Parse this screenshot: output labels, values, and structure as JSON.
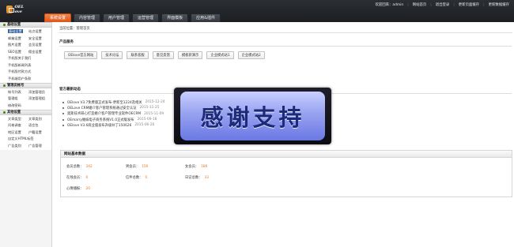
{
  "header": {
    "logo_text": "OEL ove",
    "welcome": "欢迎回来：admin",
    "links": [
      "网站首页",
      "退出登录",
      "更新页面缓存",
      "更新数据缓存"
    ],
    "tabs": [
      "系统设置",
      "内容管理",
      "用户管理",
      "运营管理",
      "界面模板",
      "应用&插件"
    ],
    "active_tab": "系统设置"
  },
  "sidebar": {
    "groups": [
      {
        "title": "基础设置",
        "items": [
          "基础设置",
          "站点设置",
          "邮箱设置",
          "安全设置",
          "图片设置",
          "会员设置",
          "SEO设置",
          "佣金设置",
          "手机版关于我们",
          "手机版新闻列表",
          "手机版付款方式",
          "手机端用户条款"
        ]
      },
      {
        "title": "管理员帐号",
        "items": [
          "帐号列表",
          "添加管理员",
          "管理组",
          "添加管理组",
          "修改密码"
        ]
      },
      {
        "title": "其他设置",
        "items": [
          "文章类型",
          "文章类别",
          "问卷调查",
          "语言包",
          "地区设置",
          "户籍设置",
          "自定义HTML标签",
          "广告类别",
          "广告管理"
        ]
      }
    ]
  },
  "main": {
    "breadcrumb": "当前位置：管理首页",
    "quick_title": "产品服务",
    "quick_buttons": [
      "OElove官方网站",
      "技术论坛",
      "联系客服",
      "意见反馈",
      "模板新演示",
      "企业模式站1",
      "企业模式站2"
    ],
    "news_title": "官方最新动态",
    "news": [
      {
        "text": "OElove V3.7免费版正式发布-更新至1224及相关",
        "date": "2015-12-24"
      },
      {
        "text": "OELove CRM婚介客户管理系统通过安全认证",
        "date": "2015-11-25"
      },
      {
        "text": "奥斯技术研心打造婚介客户管理专业软件OECRM",
        "date": "2015-11-09"
      },
      {
        "text": "OEmarry婚嫁电子商务系统V1.0正式版发布",
        "date": "2015-09-18"
      },
      {
        "text": "OElove V3.6商业版发布升级补丁150626",
        "date": "2015-06-26"
      }
    ],
    "stats_title": "网站基本数据",
    "stats": [
      {
        "label": "会员总数：",
        "value": "342"
      },
      {
        "label": "男会员：",
        "value": "156"
      },
      {
        "label": "女会员：",
        "value": "186"
      },
      {
        "label": "在线会员：",
        "value": "0"
      },
      {
        "label": "信件总数：",
        "value": "0"
      },
      {
        "label": "日记总数：",
        "value": "33"
      },
      {
        "label": "心情播报：",
        "value": "20"
      }
    ]
  },
  "overlay": {
    "text": "感谢支持"
  },
  "colors": {
    "active_tab": "#e8692c",
    "header_bg": "#23262a",
    "stat_value": "#e07a2a",
    "overlay_text": "#1d2a78"
  }
}
